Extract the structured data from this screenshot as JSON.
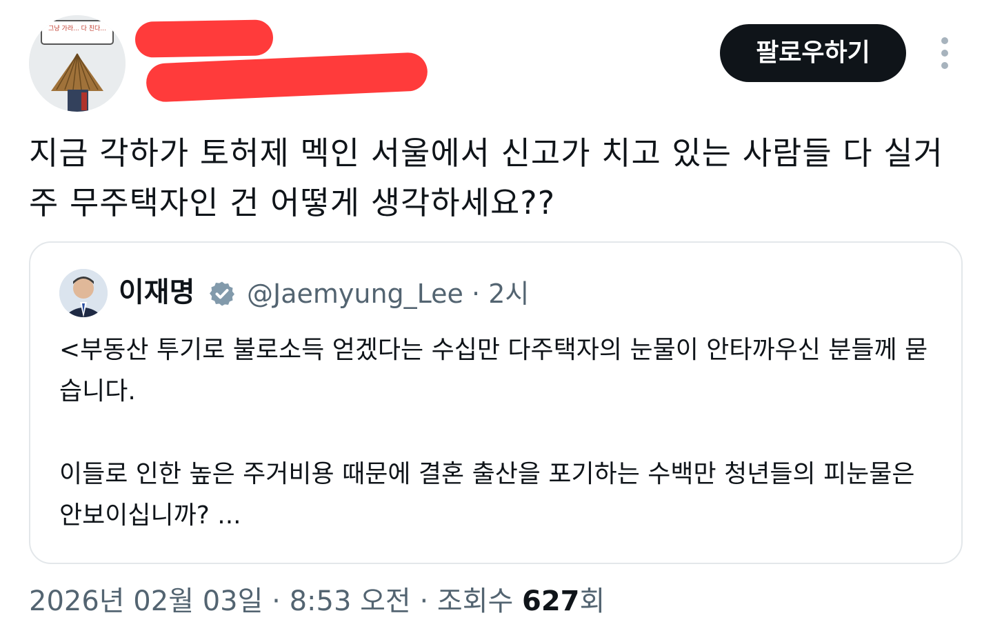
{
  "author": {
    "avatar_caption": "그냥 가라... 다 친다...",
    "follow_label": "팔로우하기"
  },
  "tweet": {
    "text": "지금 각하가 토허제 멕인 서울에서 신고가 치고 있는 사람들 다 실거주 무주택자인 건 어떻게 생각하세요??"
  },
  "quote": {
    "name": "이재명",
    "handle": "@Jaemyung_Lee",
    "separator": "·",
    "time": "2시",
    "paragraphs": [
      "<부동산 투기로 불로소득 얻겠다는 수십만 다주택자의 눈물이 안타까우신 분들께 묻습니다.",
      "이들로 인한 높은 주거비용 때문에 결혼 출산을 포기하는 수백만 청년들의 피눈물은 안보이십니까? ..."
    ]
  },
  "meta": {
    "date": "2026년 02월 03일",
    "sep": " · ",
    "time": "8:53 오전",
    "views_label": "조회수",
    "views_count": "627",
    "views_unit": "회"
  },
  "colors": {
    "text": "#0f1419",
    "secondary": "#536471",
    "follow_bg": "#0f1419",
    "redaction": "#ff3b3b",
    "card_border": "#e3e7ea",
    "verified": "#829aab"
  },
  "icons": {
    "more": "vertical-ellipsis-icon",
    "verified": "verified-badge-icon"
  }
}
